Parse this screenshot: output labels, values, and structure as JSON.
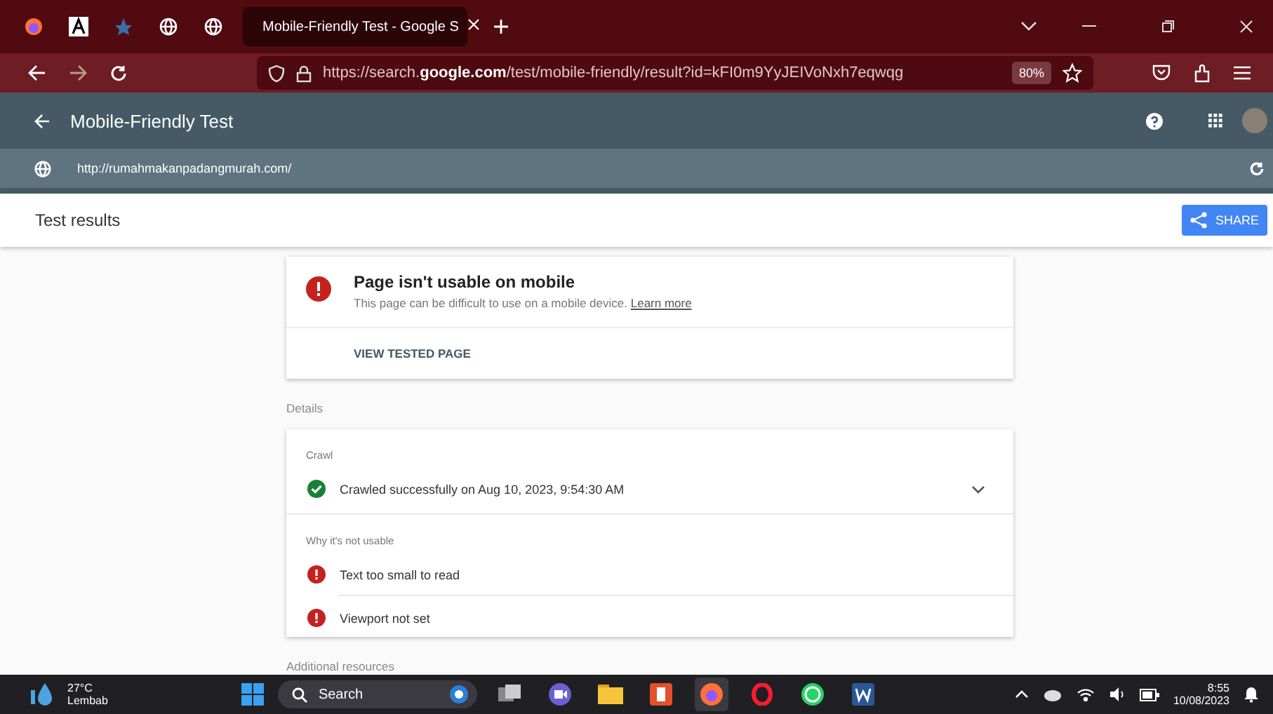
{
  "browser": {
    "tab": {
      "title": "Mobile-Friendly Test - Google S",
      "selected": true
    },
    "url_prefix": "https://search.",
    "url_domain": "google.com",
    "url_rest": "/test/mobile-friendly/result?id=kFI0m9YyJEIVoNxh7eqwqg",
    "zoom": "80%"
  },
  "app_bar": {
    "title": "Mobile-Friendly Test"
  },
  "url_bar": {
    "url": "http://rumahmakanpadangmurah.com/"
  },
  "results_bar": {
    "title": "Test results",
    "share": "SHARE"
  },
  "summary": {
    "title": "Page isn't usable on mobile",
    "text": "This page can be difficult to use on a mobile device.",
    "link": "Learn more",
    "action": "VIEW TESTED PAGE"
  },
  "details": {
    "label": "Details",
    "crawl_label": "Crawl",
    "crawl": {
      "text": "Crawled successfully on Aug 10, 2023, 9:54:30 AM",
      "kind": "success",
      "expanded": false
    },
    "issues_label": "Why it's not usable",
    "issues": [
      {
        "text": "Text too small to read",
        "kind": "error"
      },
      {
        "text": "Viewport not set",
        "kind": "error"
      }
    ]
  },
  "more_label": "Additional resources",
  "taskbar": {
    "temperature": "27°C",
    "weather": "Lembab",
    "search": "Search",
    "time": "8:55",
    "date": "10/08/2023"
  }
}
